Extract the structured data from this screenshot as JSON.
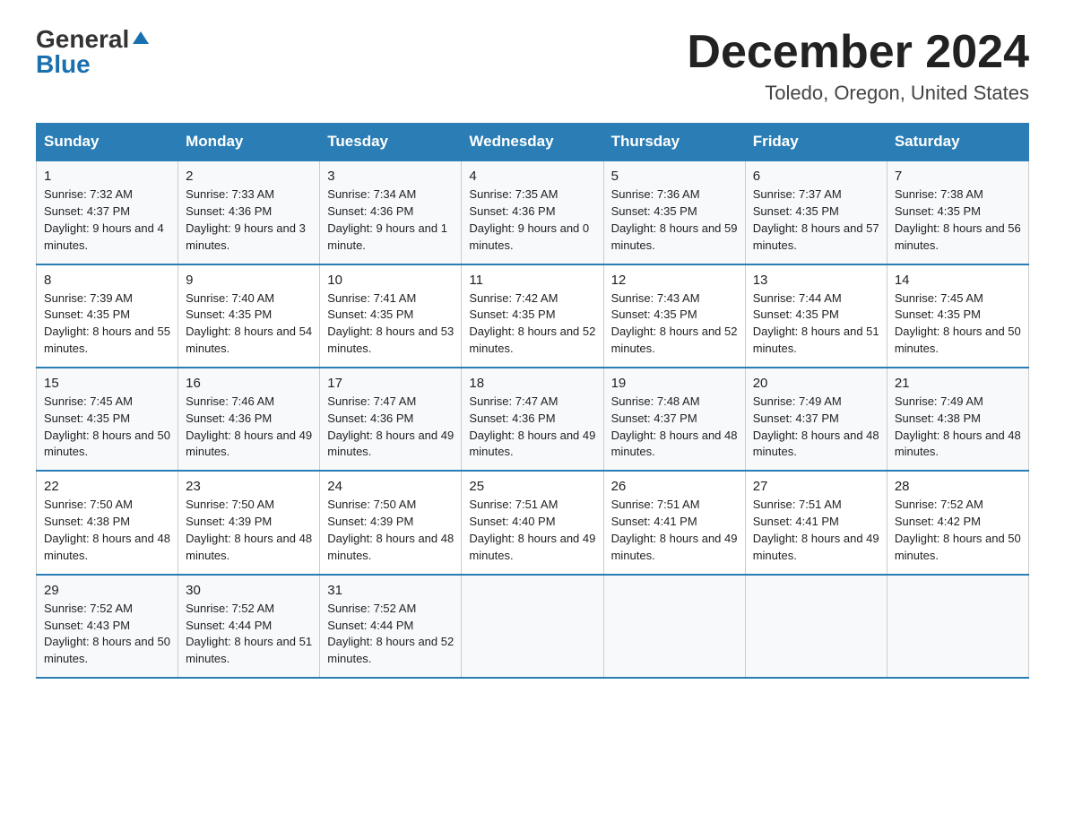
{
  "header": {
    "logo_general": "General",
    "logo_blue": "Blue",
    "month": "December 2024",
    "location": "Toledo, Oregon, United States"
  },
  "weekdays": [
    "Sunday",
    "Monday",
    "Tuesday",
    "Wednesday",
    "Thursday",
    "Friday",
    "Saturday"
  ],
  "weeks": [
    [
      {
        "day": "1",
        "sunrise": "7:32 AM",
        "sunset": "4:37 PM",
        "daylight": "9 hours and 4 minutes."
      },
      {
        "day": "2",
        "sunrise": "7:33 AM",
        "sunset": "4:36 PM",
        "daylight": "9 hours and 3 minutes."
      },
      {
        "day": "3",
        "sunrise": "7:34 AM",
        "sunset": "4:36 PM",
        "daylight": "9 hours and 1 minute."
      },
      {
        "day": "4",
        "sunrise": "7:35 AM",
        "sunset": "4:36 PM",
        "daylight": "9 hours and 0 minutes."
      },
      {
        "day": "5",
        "sunrise": "7:36 AM",
        "sunset": "4:35 PM",
        "daylight": "8 hours and 59 minutes."
      },
      {
        "day": "6",
        "sunrise": "7:37 AM",
        "sunset": "4:35 PM",
        "daylight": "8 hours and 57 minutes."
      },
      {
        "day": "7",
        "sunrise": "7:38 AM",
        "sunset": "4:35 PM",
        "daylight": "8 hours and 56 minutes."
      }
    ],
    [
      {
        "day": "8",
        "sunrise": "7:39 AM",
        "sunset": "4:35 PM",
        "daylight": "8 hours and 55 minutes."
      },
      {
        "day": "9",
        "sunrise": "7:40 AM",
        "sunset": "4:35 PM",
        "daylight": "8 hours and 54 minutes."
      },
      {
        "day": "10",
        "sunrise": "7:41 AM",
        "sunset": "4:35 PM",
        "daylight": "8 hours and 53 minutes."
      },
      {
        "day": "11",
        "sunrise": "7:42 AM",
        "sunset": "4:35 PM",
        "daylight": "8 hours and 52 minutes."
      },
      {
        "day": "12",
        "sunrise": "7:43 AM",
        "sunset": "4:35 PM",
        "daylight": "8 hours and 52 minutes."
      },
      {
        "day": "13",
        "sunrise": "7:44 AM",
        "sunset": "4:35 PM",
        "daylight": "8 hours and 51 minutes."
      },
      {
        "day": "14",
        "sunrise": "7:45 AM",
        "sunset": "4:35 PM",
        "daylight": "8 hours and 50 minutes."
      }
    ],
    [
      {
        "day": "15",
        "sunrise": "7:45 AM",
        "sunset": "4:35 PM",
        "daylight": "8 hours and 50 minutes."
      },
      {
        "day": "16",
        "sunrise": "7:46 AM",
        "sunset": "4:36 PM",
        "daylight": "8 hours and 49 minutes."
      },
      {
        "day": "17",
        "sunrise": "7:47 AM",
        "sunset": "4:36 PM",
        "daylight": "8 hours and 49 minutes."
      },
      {
        "day": "18",
        "sunrise": "7:47 AM",
        "sunset": "4:36 PM",
        "daylight": "8 hours and 49 minutes."
      },
      {
        "day": "19",
        "sunrise": "7:48 AM",
        "sunset": "4:37 PM",
        "daylight": "8 hours and 48 minutes."
      },
      {
        "day": "20",
        "sunrise": "7:49 AM",
        "sunset": "4:37 PM",
        "daylight": "8 hours and 48 minutes."
      },
      {
        "day": "21",
        "sunrise": "7:49 AM",
        "sunset": "4:38 PM",
        "daylight": "8 hours and 48 minutes."
      }
    ],
    [
      {
        "day": "22",
        "sunrise": "7:50 AM",
        "sunset": "4:38 PM",
        "daylight": "8 hours and 48 minutes."
      },
      {
        "day": "23",
        "sunrise": "7:50 AM",
        "sunset": "4:39 PM",
        "daylight": "8 hours and 48 minutes."
      },
      {
        "day": "24",
        "sunrise": "7:50 AM",
        "sunset": "4:39 PM",
        "daylight": "8 hours and 48 minutes."
      },
      {
        "day": "25",
        "sunrise": "7:51 AM",
        "sunset": "4:40 PM",
        "daylight": "8 hours and 49 minutes."
      },
      {
        "day": "26",
        "sunrise": "7:51 AM",
        "sunset": "4:41 PM",
        "daylight": "8 hours and 49 minutes."
      },
      {
        "day": "27",
        "sunrise": "7:51 AM",
        "sunset": "4:41 PM",
        "daylight": "8 hours and 49 minutes."
      },
      {
        "day": "28",
        "sunrise": "7:52 AM",
        "sunset": "4:42 PM",
        "daylight": "8 hours and 50 minutes."
      }
    ],
    [
      {
        "day": "29",
        "sunrise": "7:52 AM",
        "sunset": "4:43 PM",
        "daylight": "8 hours and 50 minutes."
      },
      {
        "day": "30",
        "sunrise": "7:52 AM",
        "sunset": "4:44 PM",
        "daylight": "8 hours and 51 minutes."
      },
      {
        "day": "31",
        "sunrise": "7:52 AM",
        "sunset": "4:44 PM",
        "daylight": "8 hours and 52 minutes."
      },
      null,
      null,
      null,
      null
    ]
  ],
  "labels": {
    "sunrise": "Sunrise:",
    "sunset": "Sunset:",
    "daylight": "Daylight:"
  }
}
